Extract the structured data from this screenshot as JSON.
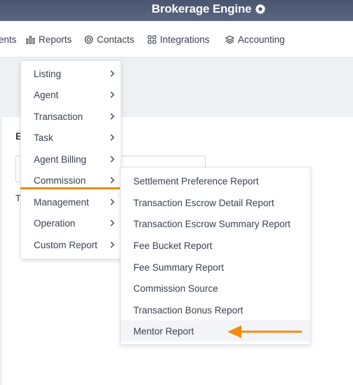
{
  "header": {
    "brand": "Brokerage Engine",
    "brand_icon": "gear-icon",
    "bg_color": "#4a5570"
  },
  "nav": {
    "items": [
      {
        "label": "ents",
        "icon": ""
      },
      {
        "label": "Reports",
        "icon": "bar-chart-icon"
      },
      {
        "label": "Contacts",
        "icon": "target-icon"
      },
      {
        "label": "Integrations",
        "icon": "grid-icon"
      },
      {
        "label": "Accounting",
        "icon": "layers-icon"
      }
    ]
  },
  "panel": {
    "heading": "E",
    "label": "T"
  },
  "reports_menu": {
    "items": [
      {
        "label": "Listing"
      },
      {
        "label": "Agent"
      },
      {
        "label": "Transaction"
      },
      {
        "label": "Task"
      },
      {
        "label": "Agent Billing"
      },
      {
        "label": "Commission"
      },
      {
        "label": "Management"
      },
      {
        "label": "Operation"
      },
      {
        "label": "Custom Report"
      }
    ],
    "active": "Commission"
  },
  "commission_submenu": {
    "items": [
      {
        "label": "Settlement Preference Report"
      },
      {
        "label": "Transaction Escrow Detail Report"
      },
      {
        "label": "Transaction Escrow Summary Report"
      },
      {
        "label": "Fee Bucket Report"
      },
      {
        "label": "Fee Summary Report"
      },
      {
        "label": "Commission Source"
      },
      {
        "label": "Transaction Bonus Report"
      },
      {
        "label": "Mentor Report"
      }
    ],
    "highlighted": "Mentor Report"
  },
  "annotation": {
    "color": "#f28c0f"
  }
}
